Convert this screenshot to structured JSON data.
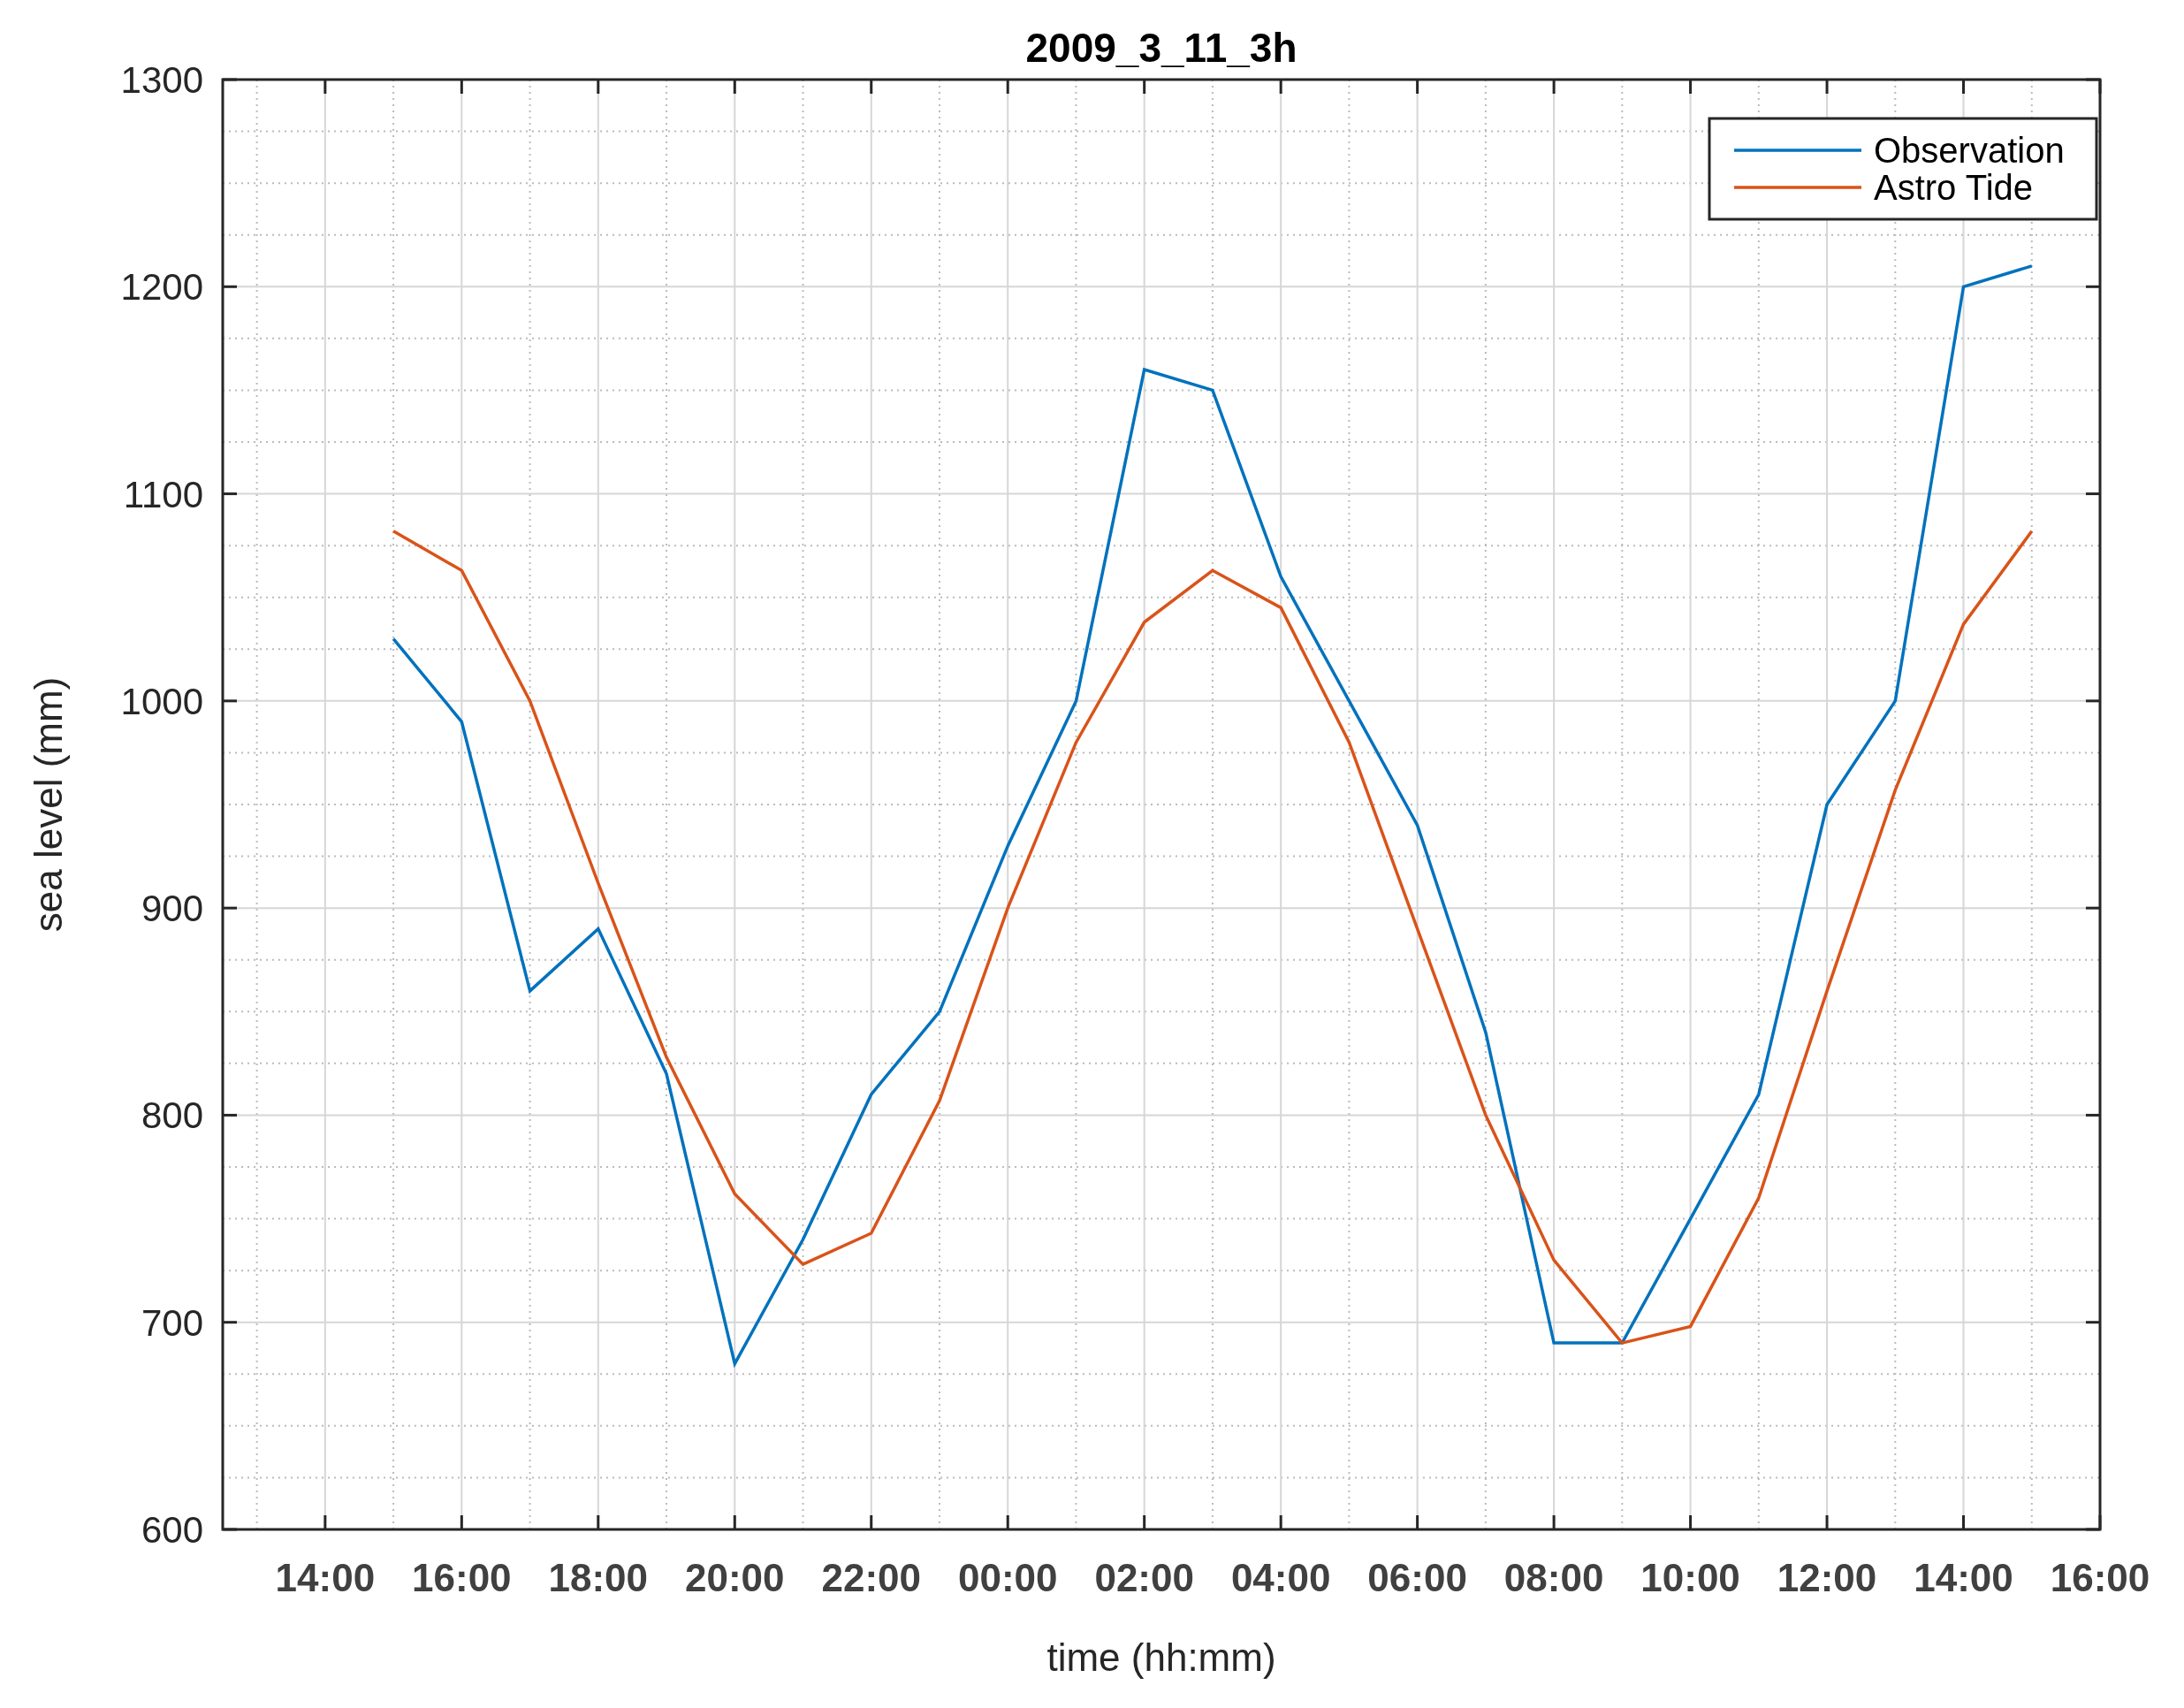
{
  "figure": {
    "chart_data": {
      "type": "line",
      "title": "2009_3_11_3h",
      "xlabel": "time (hh:mm)",
      "ylabel": "sea level (mm)",
      "categories": [
        null,
        "14:00",
        null,
        "16:00",
        null,
        "18:00",
        null,
        "20:00",
        null,
        "22:00",
        null,
        "00:00",
        null,
        "02:00",
        null,
        "04:00",
        null,
        "06:00",
        null,
        "08:00",
        null,
        "10:00",
        null,
        "12:00",
        null,
        "14:00",
        null,
        "16:00"
      ],
      "series": [
        {
          "name": "Observation",
          "color": "#0072bd",
          "values": [
            null,
            null,
            1030,
            990,
            860,
            890,
            820,
            680,
            740,
            810,
            850,
            930,
            1000,
            1160,
            1150,
            1060,
            1000,
            940,
            840,
            690,
            690,
            750,
            810,
            950,
            1000,
            1200,
            1210,
            null
          ]
        },
        {
          "name": "Astro Tide",
          "color": "#d95319",
          "values": [
            null,
            null,
            1082,
            1063,
            1000,
            912,
            828,
            762,
            728,
            743,
            807,
            900,
            980,
            1038,
            1063,
            1045,
            980,
            890,
            800,
            730,
            690,
            698,
            760,
            860,
            957,
            1037,
            1082,
            null
          ]
        }
      ],
      "grid": true,
      "legend": true,
      "ylim": [
        600,
        1300
      ],
      "yticks": [
        600,
        700,
        800,
        900,
        1000,
        1100,
        1200,
        1300
      ]
    }
  }
}
